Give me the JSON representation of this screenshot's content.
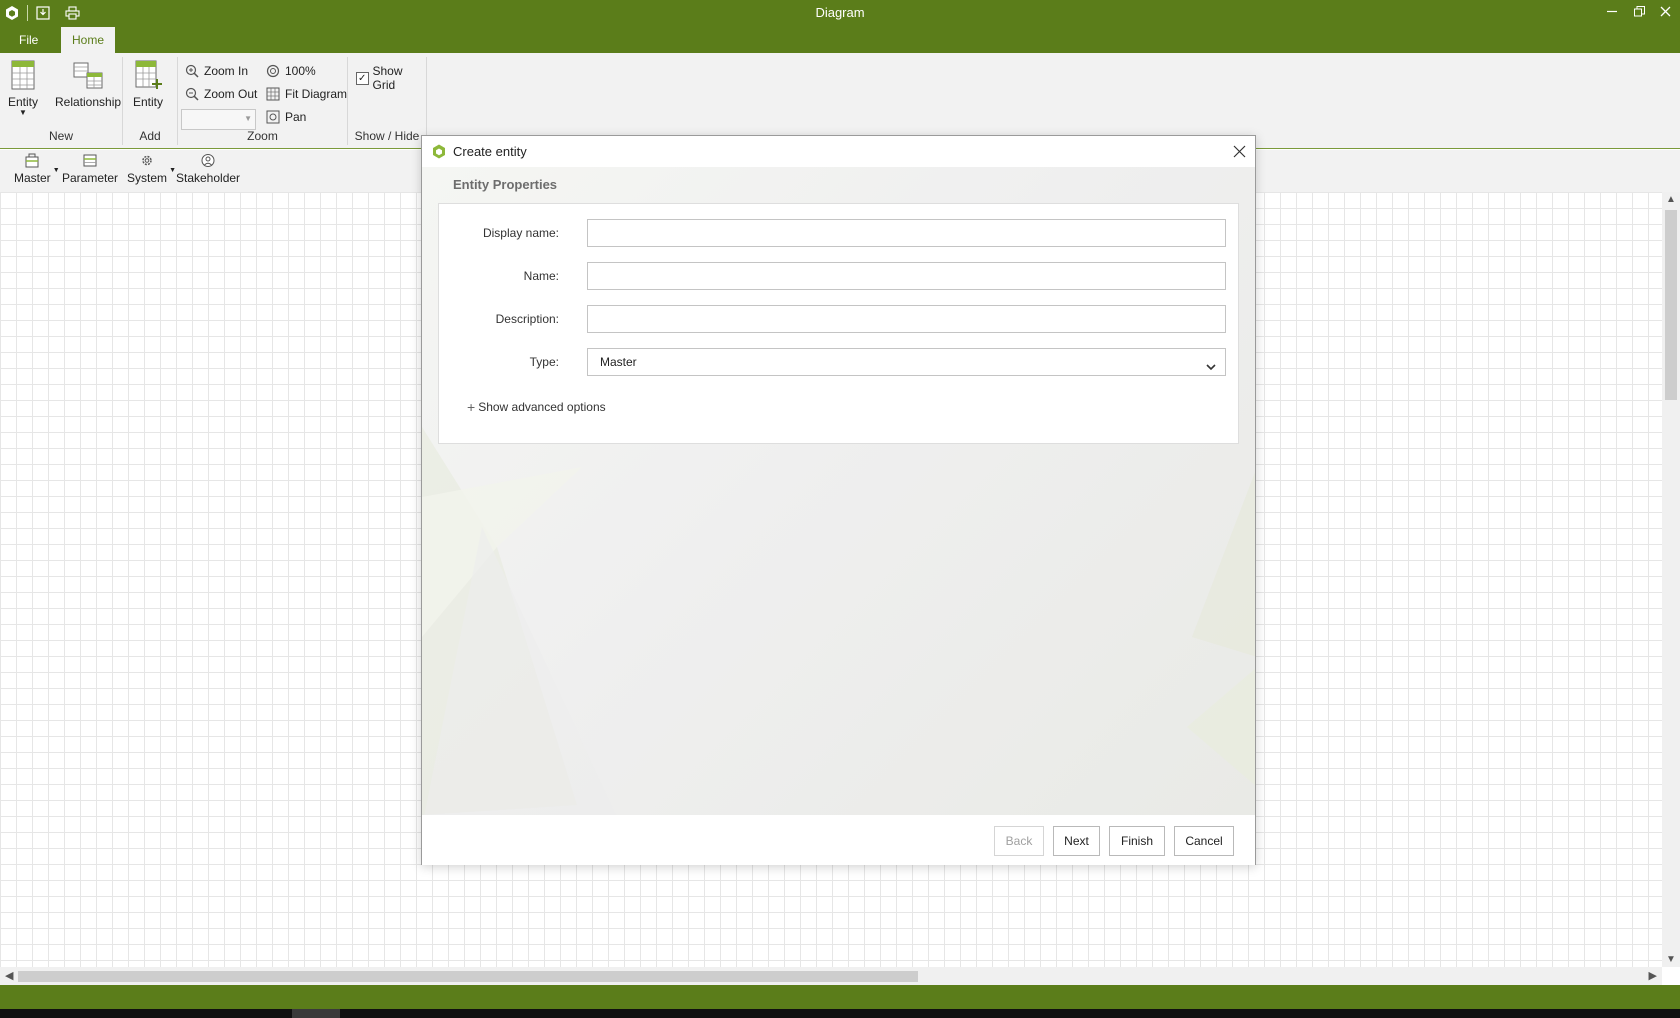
{
  "window": {
    "title": "Diagram"
  },
  "quick_access": {
    "icons": [
      "app-logo-icon",
      "save-icon",
      "print-icon"
    ]
  },
  "menu": {
    "tabs": [
      {
        "label": "File"
      },
      {
        "label": "Home"
      }
    ],
    "active": "Home"
  },
  "ribbon": {
    "new_group": {
      "label": "New",
      "entity": "Entity",
      "relationship": "Relationship"
    },
    "add_group": {
      "label": "Add",
      "entity": "Entity"
    },
    "zoom_group": {
      "label": "Zoom",
      "zoom_in": "Zoom In",
      "zoom_out": "Zoom Out",
      "hundred": "100%",
      "fit": "Fit Diagram",
      "pan": "Pan",
      "zoom_value": ""
    },
    "show_group": {
      "label": "Show / Hide",
      "show_grid": "Show Grid",
      "show_grid_checked": true
    }
  },
  "palette": {
    "items": [
      {
        "label": "Master"
      },
      {
        "label": "Parameter"
      },
      {
        "label": "System"
      },
      {
        "label": "Stakeholder"
      }
    ]
  },
  "dialog": {
    "title": "Create entity",
    "section_title": "Entity Properties",
    "fields": {
      "display_name": {
        "label": "Display name:",
        "value": ""
      },
      "name": {
        "label": "Name:",
        "value": ""
      },
      "description": {
        "label": "Description:",
        "value": ""
      },
      "type": {
        "label": "Type:",
        "value": "Master"
      }
    },
    "advanced_link": "Show advanced options",
    "buttons": {
      "back": "Back",
      "next": "Next",
      "finish": "Finish",
      "cancel": "Cancel"
    }
  },
  "colors": {
    "brand": "#5b7d1a",
    "accent_light": "#8db83a",
    "ribbon_bg": "#f2f2f2"
  }
}
